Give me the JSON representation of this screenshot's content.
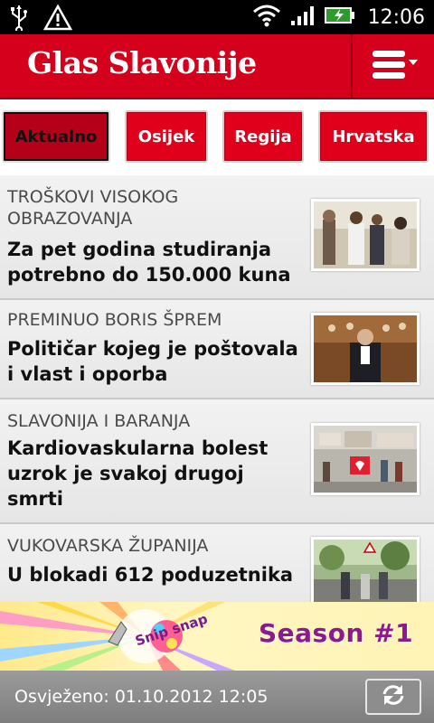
{
  "status_bar": {
    "time": "12:06",
    "icons": [
      "usb-icon",
      "warning-icon",
      "wifi-icon",
      "signal-icon",
      "battery-charging-icon"
    ]
  },
  "app": {
    "title": "Glas Slavonije",
    "brand_color": "#d5001b"
  },
  "tabs": [
    {
      "label": "Aktualno",
      "active": true
    },
    {
      "label": "Osijek",
      "active": false
    },
    {
      "label": "Regija",
      "active": false
    },
    {
      "label": "Hrvatska",
      "active": false
    }
  ],
  "news": [
    {
      "category": "TROŠKOVI VISOKOG OBRAZOVANJA",
      "headline": "Za pet godina studiranja potrebno do 150.000 kuna"
    },
    {
      "category": "PREMINUO BORIS ŠPREM",
      "headline": "Političar kojeg je poštovala i vlast i oporba"
    },
    {
      "category": "SLAVONIJA I BARANJA",
      "headline": "Kardiovaskularna bolest uzrok je svakoj drugoj smrti"
    },
    {
      "category": "VUKOVARSKA ŽUPANIJA",
      "headline": "U blokadi 612 poduzetnika"
    }
  ],
  "ad": {
    "logo_text": "Snip snap",
    "season_text": "Season #1"
  },
  "footer": {
    "refreshed_text": "Osvježeno: 01.10.2012 12:05"
  }
}
